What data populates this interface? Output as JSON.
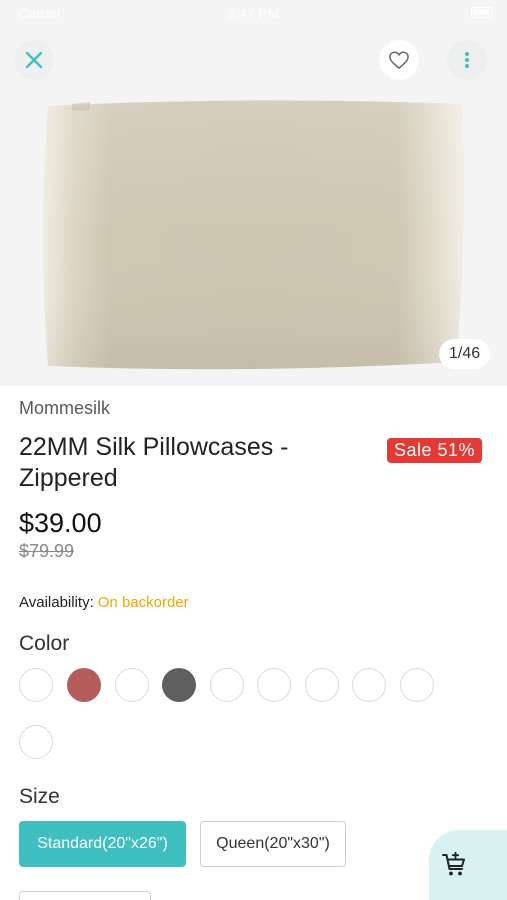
{
  "status_bar": {
    "carrier": "Carrier",
    "time": "3:47 PM"
  },
  "gallery": {
    "counter": "1/46",
    "image_alt": "22MM Silk Pillowcase champagne"
  },
  "product": {
    "brand": "Mommesilk",
    "title": "22MM Silk Pillowcases - Zippered",
    "sale_badge": "Sale 51%",
    "price": "$39.00",
    "old_price": "$79.99",
    "availability_label": "Availability:",
    "availability_status": "On backorder"
  },
  "options": {
    "color_label": "Color",
    "colors": [
      "#ffffff",
      "#b55c5c",
      "#ffffff",
      "#5f5f5f",
      "#ffffff",
      "#ffffff",
      "#ffffff",
      "#ffffff",
      "#ffffff",
      "#ffffff"
    ],
    "size_label": "Size",
    "sizes": [
      "Standard(20\"x26\")",
      "Queen(20\"x30\")"
    ],
    "selected_size": "Standard(20\"x26\")"
  },
  "theme": {
    "accent": "#3fbfbf",
    "sale": "#e53935",
    "warning": "#f0a800"
  },
  "icons": {
    "close": "close-icon",
    "favorite": "heart-icon",
    "more": "more-vertical-icon",
    "cart": "add-to-cart-icon"
  }
}
